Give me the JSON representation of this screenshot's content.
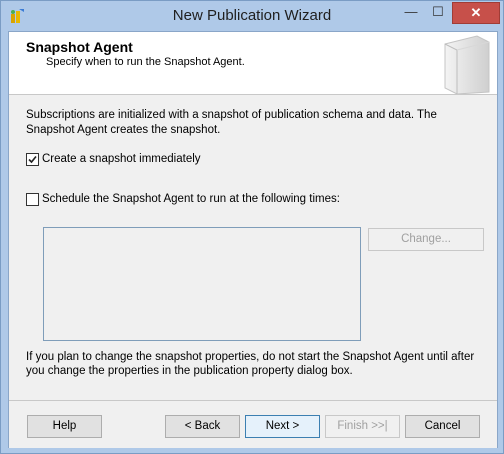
{
  "window": {
    "title": "New Publication Wizard",
    "minimize_glyph": "—",
    "maximize_glyph": "☐",
    "close_glyph": "✕"
  },
  "header": {
    "title": "Snapshot Agent",
    "subtitle": "Specify when to run the Snapshot Agent."
  },
  "body": {
    "intro": "Subscriptions are initialized with a snapshot of publication schema and data. The Snapshot Agent creates the snapshot.",
    "create_snapshot": {
      "label": "Create a snapshot immediately",
      "checked": true
    },
    "schedule_agent": {
      "label": "Schedule the Snapshot Agent to run at the following times:",
      "checked": false
    },
    "change_button": "Change...",
    "note": "If you plan to change the snapshot properties, do not start the Snapshot Agent until after you change the properties in the publication property dialog box."
  },
  "footer": {
    "help": "Help",
    "back": "< Back",
    "next": "Next >",
    "finish": "Finish >>|",
    "cancel": "Cancel"
  }
}
